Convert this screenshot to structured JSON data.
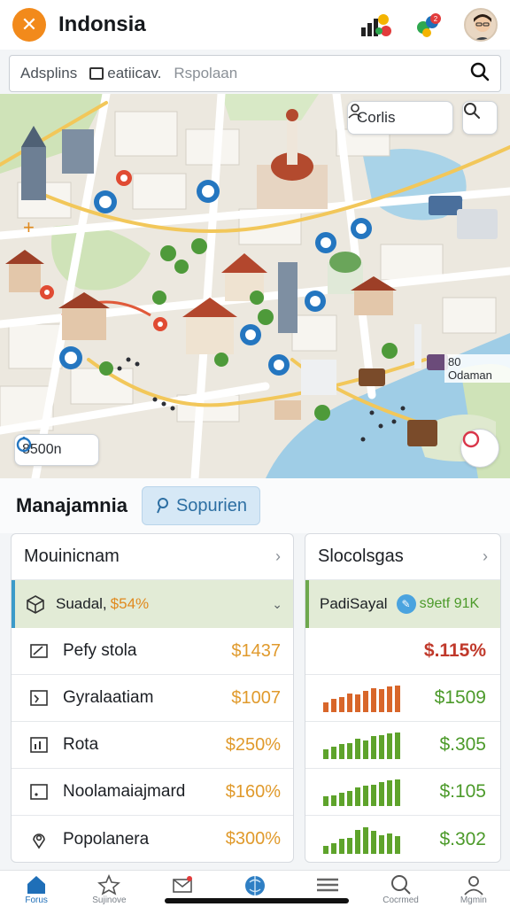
{
  "header": {
    "title": "Indonsia"
  },
  "search": {
    "segments": [
      {
        "icon": "filter-icon",
        "label": "Adsplins"
      },
      {
        "icon": "checkbox-icon",
        "label": "eatiicav."
      },
      {
        "icon": "",
        "label": "Rspolaan"
      }
    ]
  },
  "map": {
    "places_chip": "Corlis",
    "time_chip": "8500n",
    "distance_label": "80 Odaman"
  },
  "section": {
    "title": "Manajamnia",
    "chip_label": "Sopurien"
  },
  "left_card": {
    "title": "Mouinicnam",
    "summary": {
      "label": "Suadal,",
      "value": "$54%"
    },
    "rows": [
      {
        "icon": "pen-icon",
        "label": "Pefy stola",
        "value": "$1437"
      },
      {
        "icon": "wallet-icon",
        "label": "Gyralaatiam",
        "value": "$1007"
      },
      {
        "icon": "chart-icon",
        "label": "Rota",
        "value": "$250%"
      },
      {
        "icon": "box-icon",
        "label": "Noolamaiajmard",
        "value": "$160%"
      },
      {
        "icon": "pin-icon",
        "label": "Popolanera",
        "value": "$300%"
      }
    ]
  },
  "right_card": {
    "title": "Slocolsgas",
    "summary": {
      "label": "PadiSayal",
      "value": "s9etf 91K"
    },
    "headline_value": "$.115%",
    "rows": [
      {
        "value": "$1509",
        "bars": [
          0.35,
          0.5,
          0.55,
          0.7,
          0.65,
          0.8,
          0.9,
          0.85,
          0.95,
          1.0
        ],
        "color": "#d8662a"
      },
      {
        "value": "$.305",
        "bars": [
          0.35,
          0.45,
          0.55,
          0.6,
          0.75,
          0.7,
          0.85,
          0.9,
          0.95,
          1.0
        ],
        "color": "#5ea32b"
      },
      {
        "value": "$:105",
        "bars": [
          0.35,
          0.4,
          0.5,
          0.55,
          0.7,
          0.75,
          0.8,
          0.9,
          0.95,
          1.0
        ],
        "color": "#5ea32b"
      },
      {
        "value": "$.302",
        "bars": [
          0.3,
          0.4,
          0.55,
          0.6,
          0.9,
          1.0,
          0.85,
          0.7,
          0.75,
          0.65
        ],
        "color": "#5ea32b"
      }
    ]
  },
  "nav": {
    "items": [
      {
        "icon": "home-icon",
        "label": "Forus",
        "active": true
      },
      {
        "icon": "star-icon",
        "label": "Sujinove",
        "active": false
      },
      {
        "icon": "mail-icon",
        "label": "",
        "active": false
      },
      {
        "icon": "globe-icon",
        "label": "",
        "active": false
      },
      {
        "icon": "menu-icon",
        "label": "",
        "active": false
      },
      {
        "icon": "search-icon",
        "label": "Cocrmed",
        "active": false
      },
      {
        "icon": "profile-icon",
        "label": "Mgmin",
        "active": false
      }
    ]
  },
  "colors": {
    "accent": "#f28a1b",
    "primary": "#1f6fb8",
    "positive": "#5ea32b",
    "warning": "#e09a2c",
    "negative": "#c0392b"
  }
}
